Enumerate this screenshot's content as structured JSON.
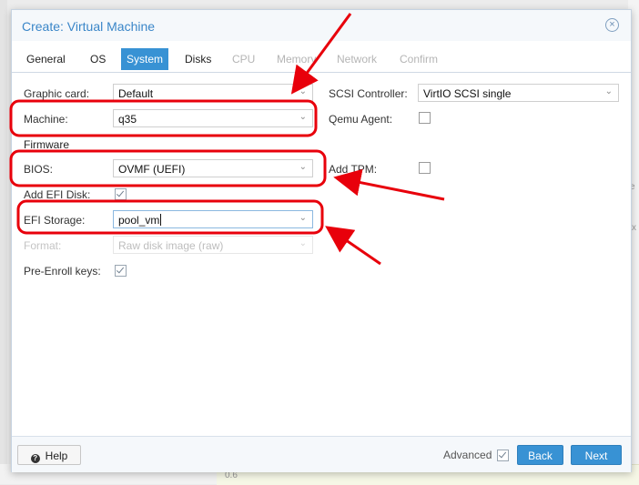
{
  "dialog": {
    "title": "Create: Virtual Machine",
    "close_icon": "circle-x-icon"
  },
  "tabs": [
    {
      "label": "General",
      "state": "normal"
    },
    {
      "label": "OS",
      "state": "normal"
    },
    {
      "label": "System",
      "state": "active"
    },
    {
      "label": "Disks",
      "state": "normal"
    },
    {
      "label": "CPU",
      "state": "disabled"
    },
    {
      "label": "Memory",
      "state": "disabled"
    },
    {
      "label": "Network",
      "state": "disabled"
    },
    {
      "label": "Confirm",
      "state": "disabled"
    }
  ],
  "left": {
    "graphic_card": {
      "label": "Graphic card:",
      "value": "Default"
    },
    "machine": {
      "label": "Machine:",
      "value": "q35"
    },
    "firmware_heading": "Firmware",
    "bios": {
      "label": "BIOS:",
      "value": "OVMF (UEFI)"
    },
    "add_efi_disk": {
      "label": "Add EFI Disk:",
      "checked": true
    },
    "efi_storage": {
      "label": "EFI Storage:",
      "value": "pool_vm"
    },
    "format": {
      "label": "Format:",
      "value": "Raw disk image (raw)"
    },
    "pre_enroll": {
      "label": "Pre-Enroll keys:",
      "checked": true
    }
  },
  "right": {
    "scsi_controller": {
      "label": "SCSI Controller:",
      "value": "VirtIO SCSI single"
    },
    "qemu_agent": {
      "label": "Qemu Agent:",
      "checked": false
    },
    "add_tpm": {
      "label": "Add TPM:",
      "checked": false
    }
  },
  "footer": {
    "help_label": "Help",
    "help_icon": "question-circle-icon",
    "advanced_label": "Advanced",
    "advanced_checked": true,
    "back_label": "Back",
    "next_label": "Next"
  },
  "background": {
    "chart_tick": "0.6",
    "edge_letters": [
      "e",
      "x"
    ]
  },
  "colors": {
    "accent": "#3892d4",
    "title": "#3a86c8",
    "annotation": "#e8000b"
  }
}
